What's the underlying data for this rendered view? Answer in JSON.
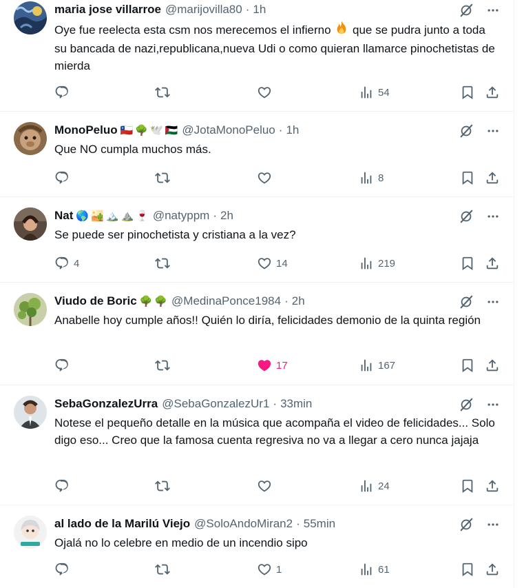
{
  "tweets": [
    {
      "name": "maria jose villarroe",
      "flair": [],
      "handle": "@marijovilla80",
      "time": "1h",
      "text_before_emoji": "Oye fue reelecta esta csm nos merecemos el infierno ",
      "inline_emoji": "fire-emoji",
      "text_after_emoji": " que se pudra junto a toda su bancada de nazi,republicana,nueva Udi o como quieran llamarce pinochetistas de mierda",
      "replies": "",
      "reposts": "",
      "likes": "",
      "views": "54",
      "liked": false
    },
    {
      "name": "MonoPeluo",
      "flair": [
        "🇨🇱",
        "🌳",
        "🕊️",
        "🇵🇸"
      ],
      "handle": "@JotaMonoPeluo",
      "time": "1h",
      "text": "Que NO cumpla muchos más.",
      "replies": "",
      "reposts": "",
      "likes": "",
      "views": "8",
      "liked": false
    },
    {
      "name": "Nat",
      "flair": [
        "🌎",
        "🏜️",
        "🏔️",
        "⛰️",
        "🍷"
      ],
      "handle": "@natyppm",
      "time": "2h",
      "text": "Se puede ser pinochetista y cristiana a la vez?",
      "replies": "4",
      "reposts": "",
      "likes": "14",
      "views": "219",
      "liked": false
    },
    {
      "name": "Viudo de Boric",
      "flair": [
        "🌳",
        "🌳"
      ],
      "handle": "@MedinaPonce1984",
      "time": "2h",
      "text": "Anabelle hoy cumple años!! Quién lo diría, felicidades demonio de la quinta región",
      "replies": "",
      "reposts": "",
      "likes": "17",
      "views": "167",
      "liked": true
    },
    {
      "name": "SebaGonzalezUrra",
      "flair": [],
      "handle": "@SebaGonzalezUr1",
      "time": "33min",
      "text": "Notese el pequeño detalle en la música que acompaña el video de felicidades... Solo digo eso... Creo que la famosa cuenta regresiva no va a llegar a cero nunca jajaja",
      "replies": "",
      "reposts": "",
      "likes": "",
      "views": "24",
      "liked": false
    },
    {
      "name": "al lado de la Marilú Viejo",
      "flair": [],
      "handle": "@SoloAndoMiran2",
      "time": "55min",
      "text": "Ojalá no lo celebre en medio de un incendio sipo",
      "replies": "",
      "reposts": "",
      "likes": "1",
      "views": "61",
      "liked": false
    }
  ],
  "separator": "·",
  "icons": {
    "reply": "reply-icon",
    "repost": "repost-icon",
    "like": "like-icon",
    "liked": "heart-filled-icon",
    "views": "views-icon",
    "bookmark": "bookmark-icon",
    "share": "share-icon",
    "grok": "grok-icon",
    "more": "more-icon"
  },
  "colors": {
    "text": "#0f1419",
    "secondary": "#536471",
    "like_active": "#f91880",
    "divider": "#eff3f4"
  }
}
